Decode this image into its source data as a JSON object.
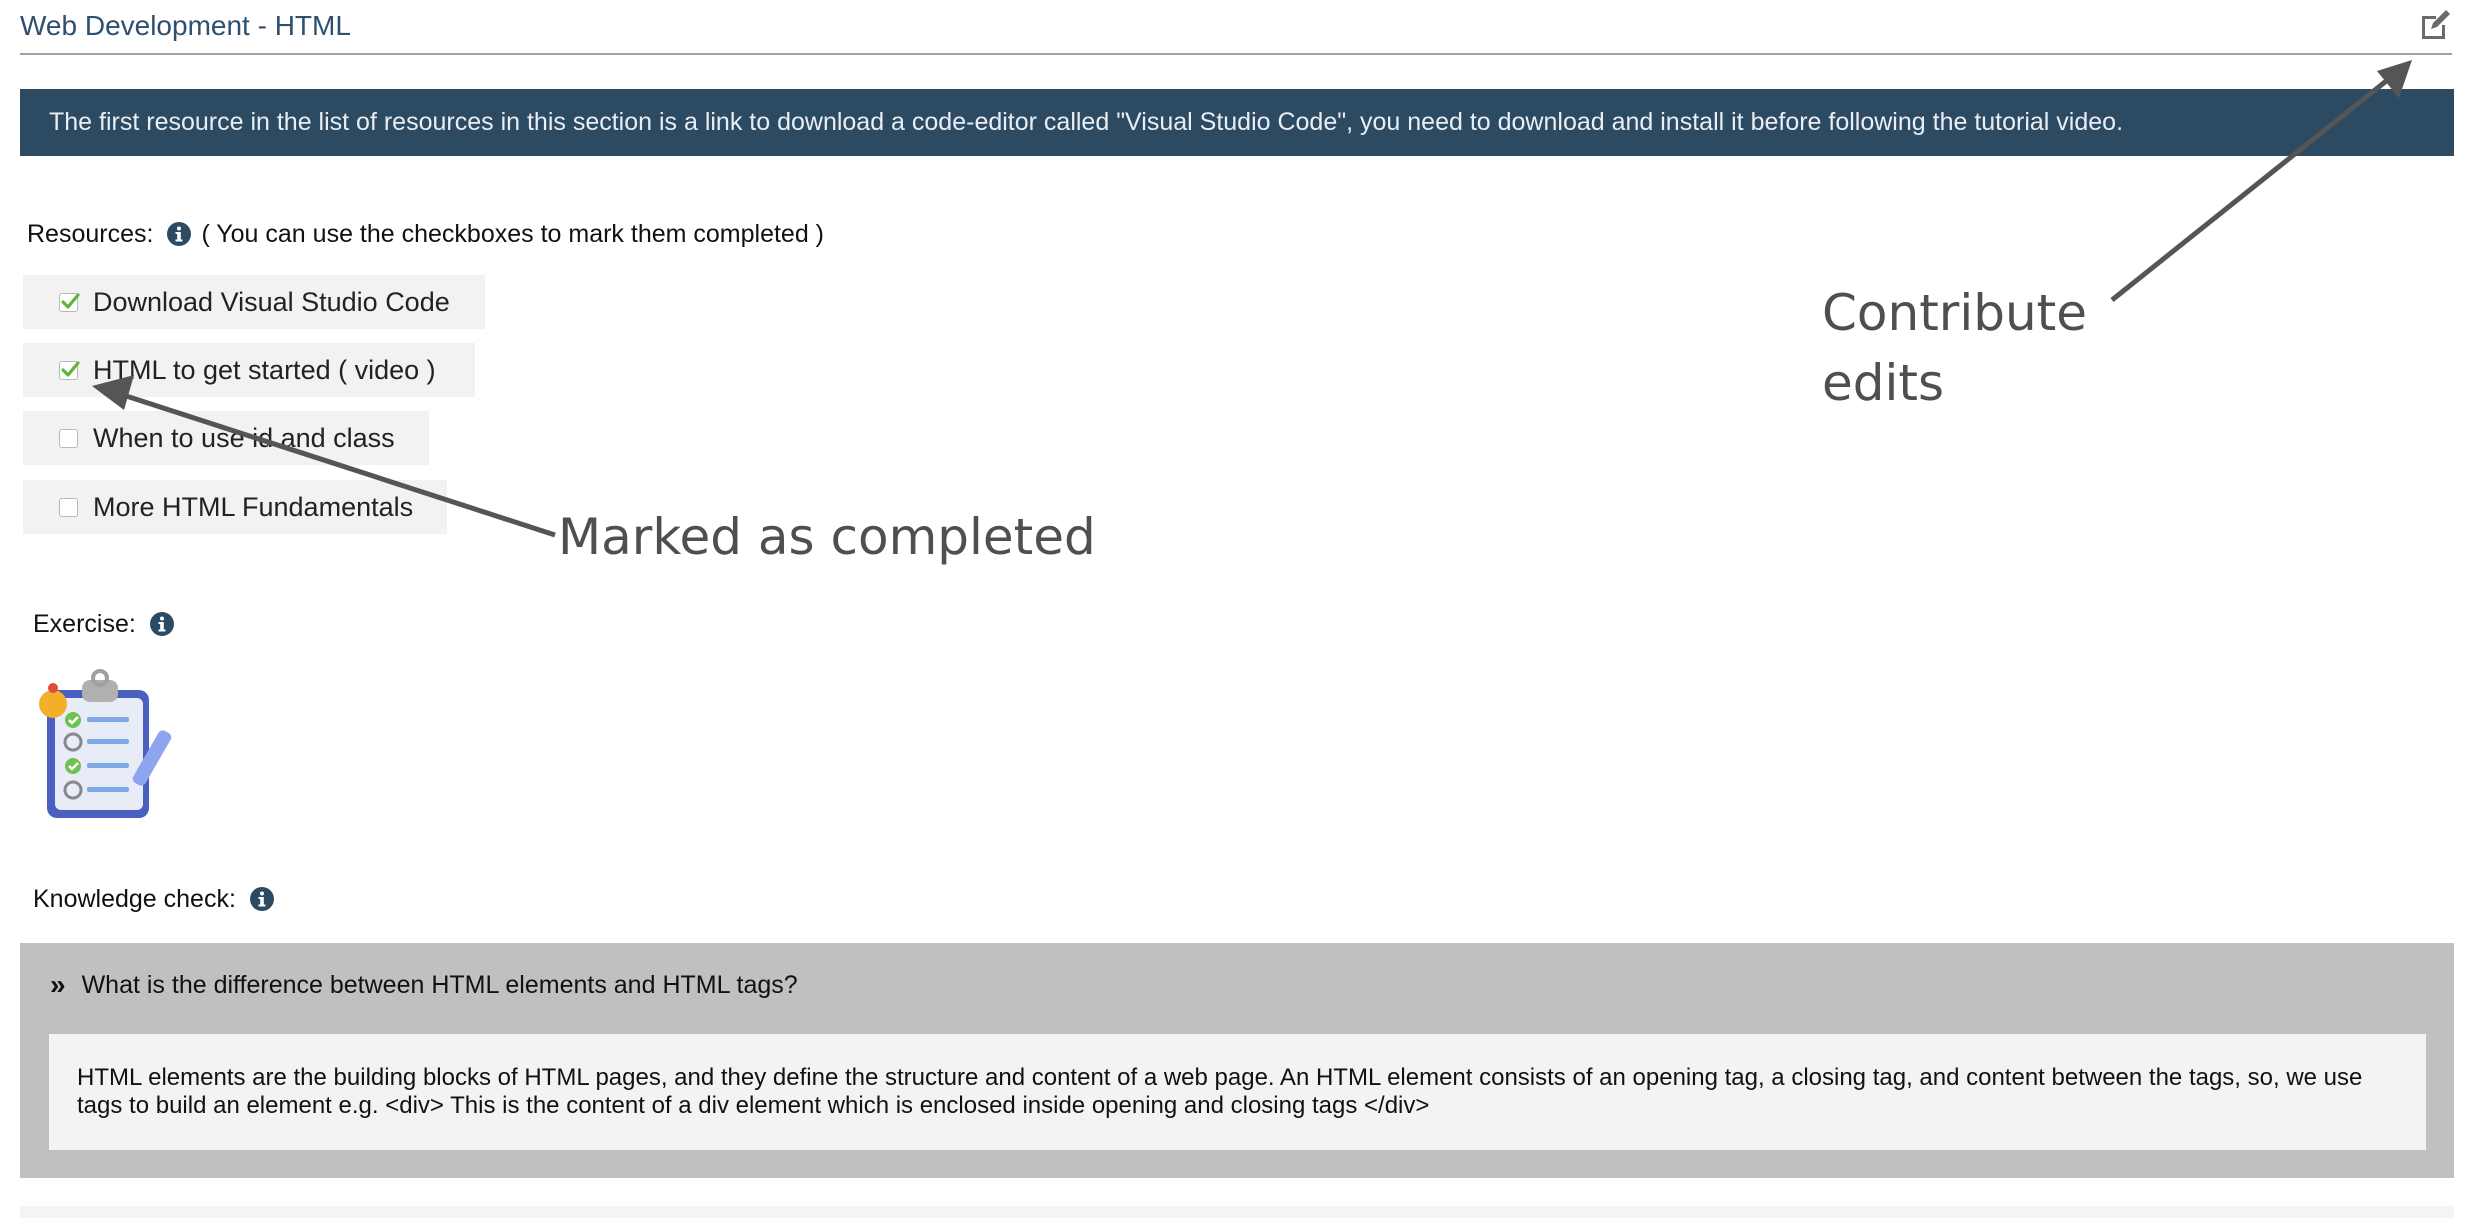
{
  "header": {
    "title": "Web Development - HTML",
    "edit_icon": "edit-pencil-icon"
  },
  "banner": {
    "text": "The first resource in the list of resources in this section is a link to download a code-editor called \"Visual Studio Code\", you need to download and install it before following the tutorial video."
  },
  "resources": {
    "label": "Resources:",
    "hint": "( You can use the checkboxes to mark them completed )",
    "items": [
      {
        "label": "Download Visual Studio Code",
        "checked": true
      },
      {
        "label": "HTML to get started ( video )",
        "checked": true
      },
      {
        "label": "When to use id and class",
        "checked": false
      },
      {
        "label": "More HTML Fundamentals",
        "checked": false
      }
    ]
  },
  "annotations": {
    "marked": "Marked as completed",
    "contribute_line1": "Contribute",
    "contribute_line2": "edits"
  },
  "exercise": {
    "label": "Exercise:",
    "image_icon": "clipboard-checklist-icon"
  },
  "knowledge_check": {
    "label": "Knowledge check:",
    "question_marker": "»",
    "question": "What is the difference between HTML elements and HTML tags?",
    "answer": "HTML elements are the building blocks of HTML pages, and they define the structure and content of a web page. An HTML element consists of an opening tag, a closing tag, and content between the tags, so, we use tags to build an element e.g. <div> This is the content of a div element which is enclosed inside opening and closing tags </div>"
  },
  "colors": {
    "title": "#2f4f6f",
    "banner_bg": "#2d4a63",
    "check_green": "#5fb53c",
    "panel_gray": "#c0c0c0",
    "annotation_gray": "#4f4f4f"
  }
}
